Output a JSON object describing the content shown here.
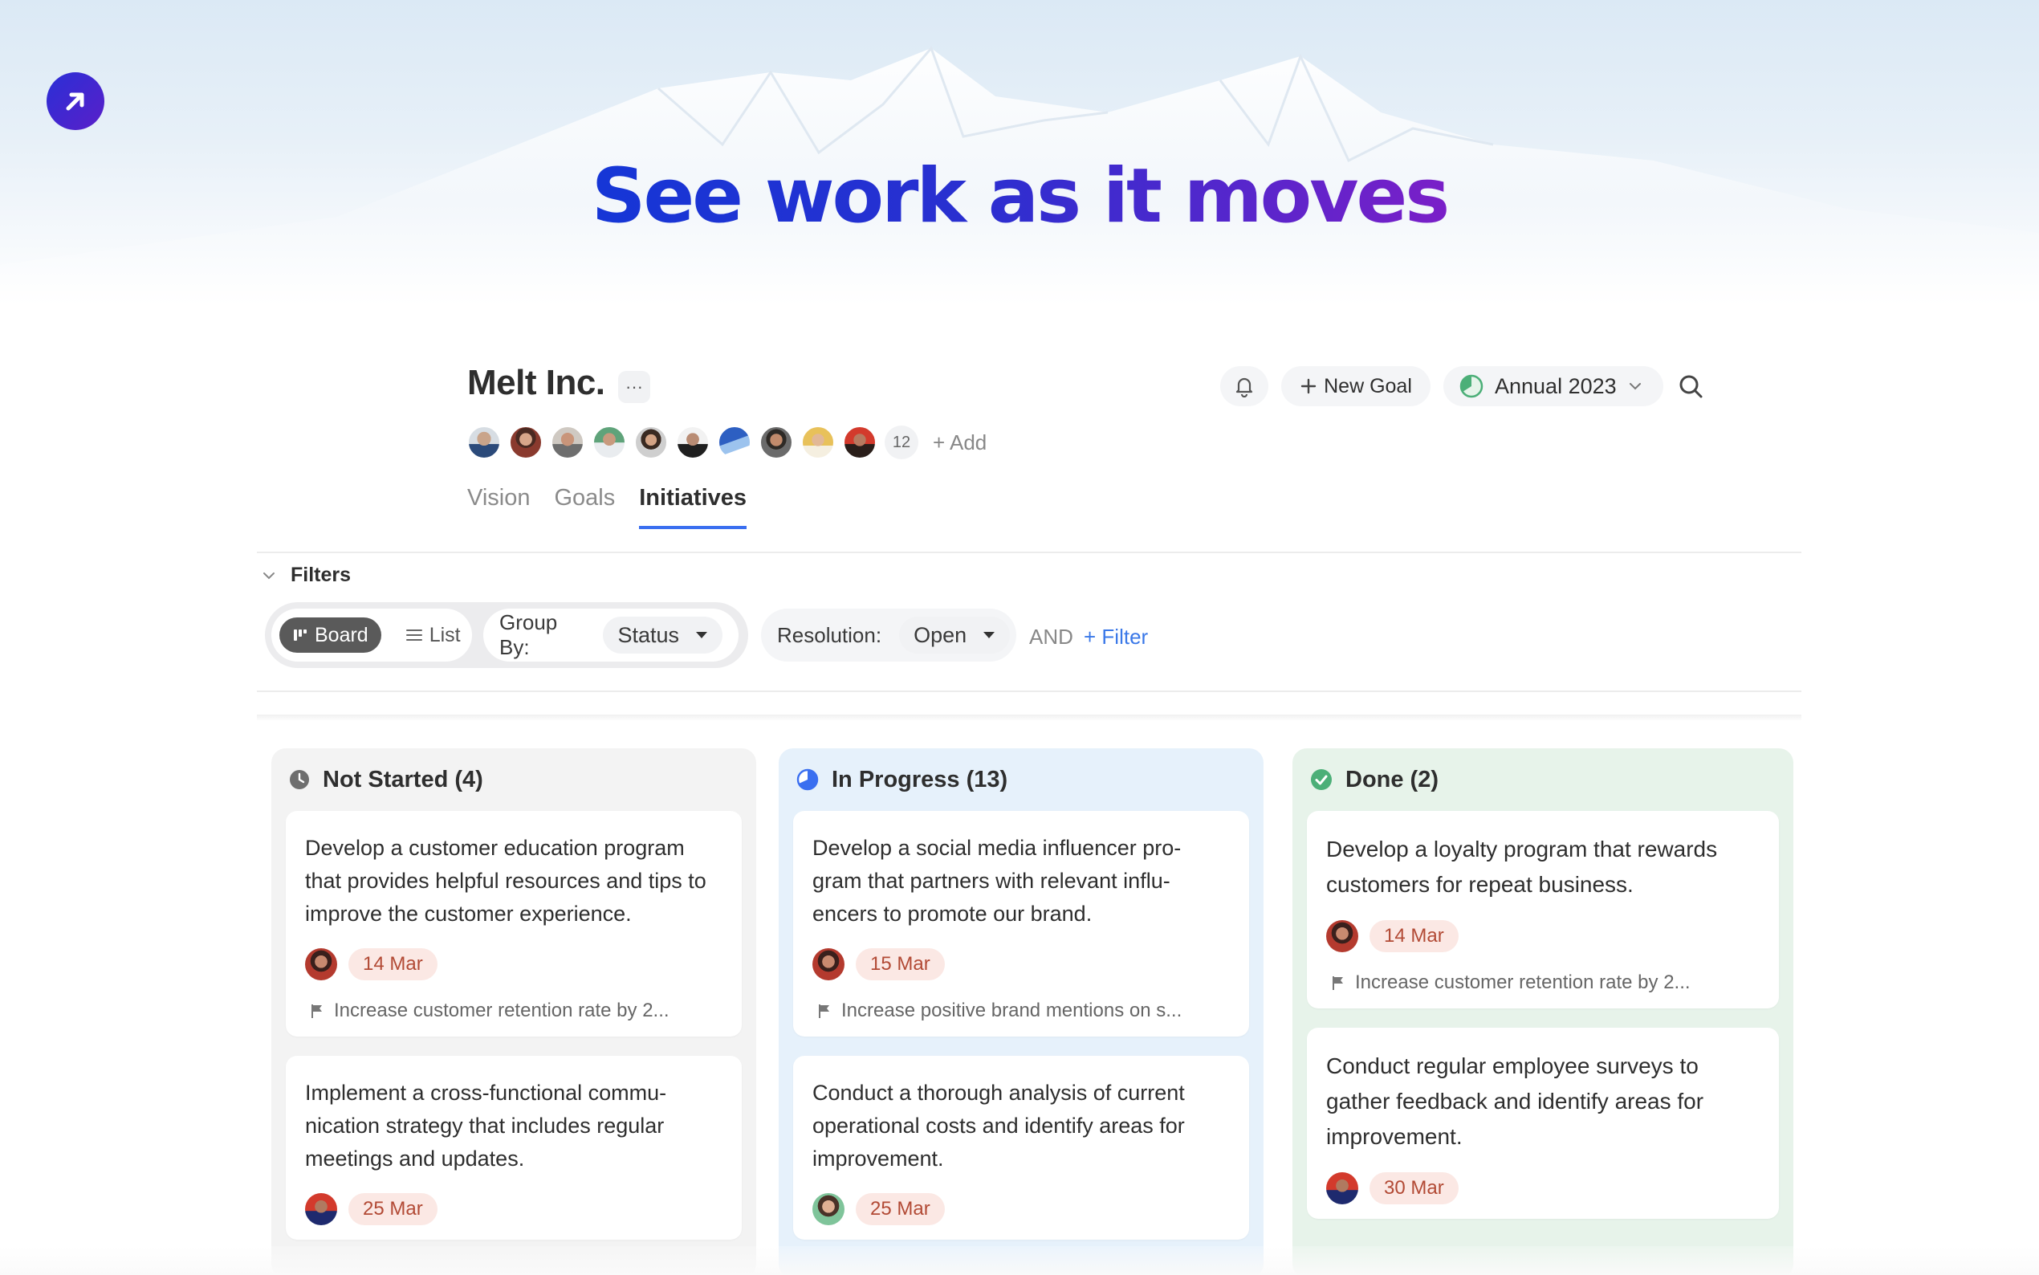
{
  "hero": {
    "title": "See work as it moves"
  },
  "workspace": {
    "name": "Melt Inc.",
    "more_label": "···",
    "member_count": "12",
    "add_label": "+ Add"
  },
  "actions": {
    "new_goal_label": "New Goal",
    "period_label": "Annual 2023"
  },
  "tabs": [
    {
      "label": "Vision"
    },
    {
      "label": "Goals"
    },
    {
      "label": "Initiatives",
      "active": true
    }
  ],
  "filters": {
    "section_label": "Filters",
    "view_board": "Board",
    "view_list": "List",
    "group_by_label": "Group By:",
    "group_by_value": "Status",
    "resolution_label": "Resolution:",
    "resolution_value": "Open",
    "and_label": "AND",
    "add_filter_label": "+ Filter"
  },
  "columns": [
    {
      "title": "Not Started (4)",
      "status_color": "#6e6e6e",
      "cards": [
        {
          "title": "Develop a customer education program that provides helpful resources and tips to improve the customer experience.",
          "date": "14 Mar",
          "goal": "Increase customer retention rate by 2..."
        },
        {
          "title": "Implement a cross-functional commu-nication strategy that includes regular meetings and updates.",
          "date": "25 Mar"
        }
      ]
    },
    {
      "title": "In Progress (13)",
      "status_color": "#3a6ff0",
      "cards": [
        {
          "title": "Develop a social media influencer pro-gram that partners with relevant influ-encers to promote our brand.",
          "date": "15 Mar",
          "goal": "Increase positive brand mentions on s..."
        },
        {
          "title": "Conduct a thorough analysis of current operational costs and identify areas for improvement.",
          "date": "25 Mar"
        }
      ]
    },
    {
      "title": "Done (2)",
      "status_color": "#4caf78",
      "cards": [
        {
          "title": "Develop a loyalty program that rewards customers for repeat business.",
          "date": "14 Mar",
          "goal": "Increase customer retention rate by 2..."
        },
        {
          "title": "Conduct regular employee surveys to gather feedback and identify areas for improvement.",
          "date": "30 Mar"
        }
      ]
    }
  ],
  "colors": {
    "accent": "#3a6ff0",
    "date_badge_bg": "#fbe8e4",
    "date_badge_text": "#b24a35",
    "not_started_bg": "#f3f3f3",
    "in_progress_bg": "#e6f1fb",
    "done_bg": "#e7f3ea"
  }
}
